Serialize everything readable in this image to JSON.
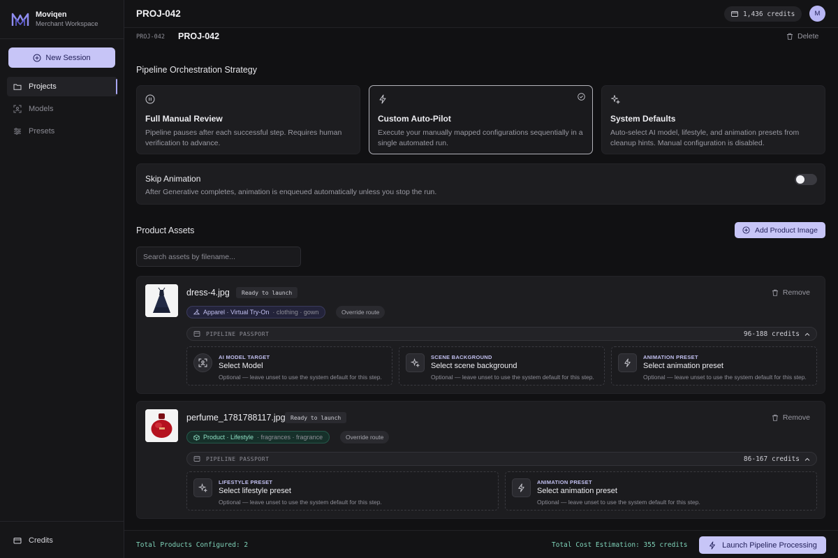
{
  "brand": {
    "name": "Moviqen",
    "subtitle": "Merchant Workspace"
  },
  "sidebar": {
    "new_session": "New Session",
    "items": [
      {
        "label": "Projects",
        "icon": "folder-icon",
        "active": true
      },
      {
        "label": "Models",
        "icon": "scan-face-icon",
        "active": false
      },
      {
        "label": "Presets",
        "icon": "sliders-icon",
        "active": false
      }
    ],
    "bottom": {
      "label": "Credits",
      "icon": "credit-card-icon"
    }
  },
  "header": {
    "title": "PROJ-042",
    "credits": "1,436 credits",
    "avatar": "M"
  },
  "subheader": {
    "project_code": "PROJ-042",
    "project_title": "PROJ-042",
    "delete": "Delete"
  },
  "strategy": {
    "title": "Pipeline Orchestration Strategy",
    "cards": [
      {
        "title": "Full Manual Review",
        "desc": "Pipeline pauses after each successful step. Requires human verification to advance.",
        "icon": "pause-circle-icon",
        "selected": false
      },
      {
        "title": "Custom Auto-Pilot",
        "desc": "Execute your manually mapped configurations sequentially in a single automated run.",
        "icon": "lightning-icon",
        "selected": true
      },
      {
        "title": "System Defaults",
        "desc": "Auto-select AI model, lifestyle, and animation presets from cleanup hints. Manual configuration is disabled.",
        "icon": "sparkles-icon",
        "selected": false
      }
    ]
  },
  "skip_animation": {
    "title": "Skip Animation",
    "desc": "After Generative completes, animation is enqueued automatically unless you stop the run.",
    "enabled": false
  },
  "assets": {
    "title": "Product Assets",
    "add_button": "Add Product Image",
    "search_placeholder": "Search assets by filename...",
    "items": [
      {
        "filename": "dress-4.jpg",
        "status": "Ready to launch",
        "remove": "Remove",
        "route": "Apparel · Virtual Try-On",
        "tags": "· clothing · gown",
        "override": "Override route",
        "passport_label": "PIPELINE PASSPORT",
        "passport_credits": "96-188 credits",
        "slots": [
          {
            "label": "AI MODEL TARGET",
            "title": "Select Model",
            "hint": "Optional — leave unset to use the system default for this step."
          },
          {
            "label": "SCENE BACKGROUND",
            "title": "Select scene background",
            "hint": "Optional — leave unset to use the system default for this step."
          },
          {
            "label": "ANIMATION PRESET",
            "title": "Select animation preset",
            "hint": "Optional — leave unset to use the system default for this step."
          }
        ]
      },
      {
        "filename": "perfume_1781788117.jpg",
        "status": "Ready to launch",
        "remove": "Remove",
        "route": "Product · Lifestyle",
        "tags": "· fragrances · fragrance",
        "override": "Override route",
        "passport_label": "PIPELINE PASSPORT",
        "passport_credits": "86-167 credits",
        "slots": [
          {
            "label": "LIFESTYLE PRESET",
            "title": "Select lifestyle preset",
            "hint": "Optional — leave unset to use the system default for this step."
          },
          {
            "label": "ANIMATION PRESET",
            "title": "Select animation preset",
            "hint": "Optional — leave unset to use the system default for this step."
          }
        ]
      }
    ]
  },
  "footer": {
    "total_products": "Total Products Configured: 2",
    "total_cost": "Total Cost Estimation: 355 credits",
    "launch": "Launch Pipeline Processing"
  },
  "colors": {
    "accent": "#c7c5f7",
    "success": "#7fd3b9",
    "background": "#111113"
  }
}
